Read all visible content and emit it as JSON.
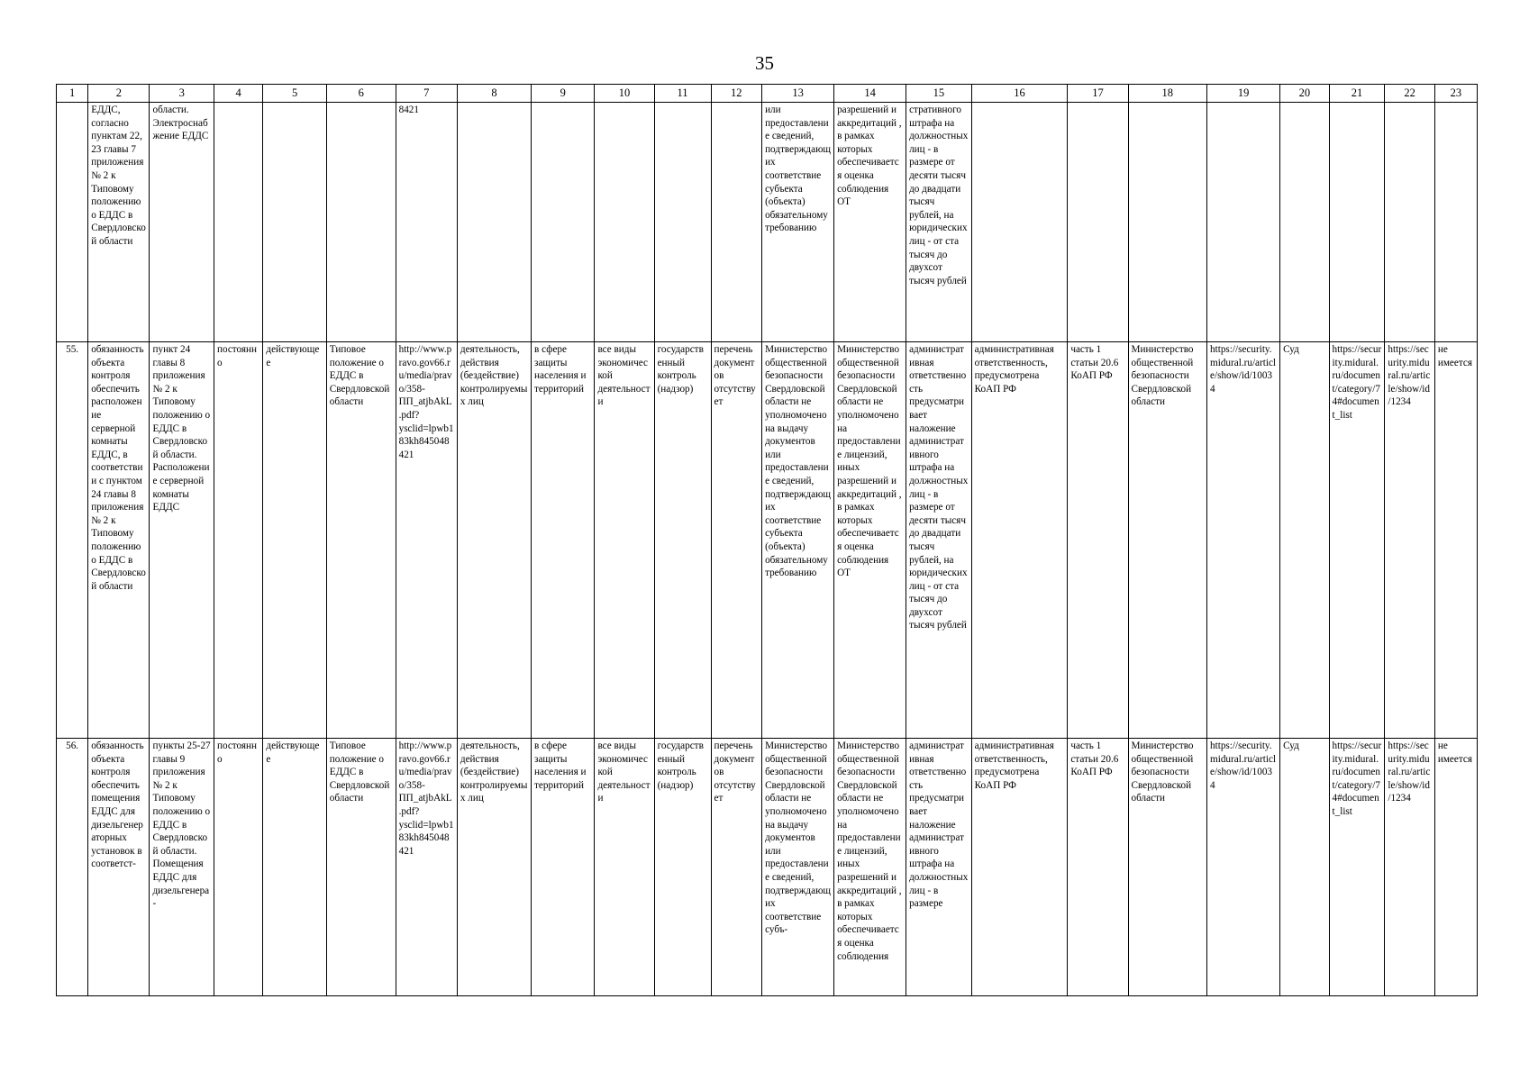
{
  "page": {
    "number": "35"
  },
  "table": {
    "column_headers": [
      "1",
      "2",
      "3",
      "4",
      "5",
      "6",
      "7",
      "8",
      "9",
      "10",
      "11",
      "12",
      "13",
      "14",
      "15",
      "16",
      "17",
      "18",
      "19",
      "20",
      "21",
      "22",
      "23"
    ],
    "rows": [
      {
        "name": "continuation-row",
        "cells": [
          "",
          "ЕДДС, согласно пунктам 22, 23 главы 7 приложения № 2 к Типовому положению о ЕДДС в Свердловской области",
          "области. Электроснабжение ЕДДС",
          "",
          "",
          "",
          "8421",
          "",
          "",
          "",
          "",
          "",
          "или предоставление сведений, подтверждающих соответствие субъекта (объекта) обязательному требованию",
          "разрешений и аккредитаций , в рамках которых обеспечивается оценка соблюдения ОТ",
          "стративного штрафа на должностных лиц - в размере от десяти тысяч до двадцати тысяч рублей, на юридических лиц - от ста тысяч до двухсот тысяч рублей",
          "",
          "",
          "",
          "",
          "",
          "",
          "",
          ""
        ]
      },
      {
        "name": "row-55",
        "cells": [
          "55.",
          "обязанность объекта контроля обеспечить расположение серверной комнаты ЕДДС, в соответствии с пунктом 24 главы 8 приложения № 2 к Типовому положению о ЕДДС в Свердловской области",
          "пункт 24 главы 8 приложения № 2 к Типовому положению о ЕДДС в Свердловской области. Расположение серверной комнаты ЕДДС",
          "постоянно",
          "действующее",
          "Типовое положение о ЕДДС в Свердловской области",
          "http://www.pravo.gov66.ru/media/pravo/358-ПП_atjbAkL.pdf?ysclid=lpwb183kh845048421",
          "деятельность, действия (бездействие) контролируемых лиц",
          "в сфере защиты населения и территорий",
          "все виды экономической деятельности",
          "государственный контроль (надзор)",
          "перечень документов отсутствует",
          "Министерство общественной безопасности Свердловской области не уполномочено на выдачу документов или предоставление сведений, подтверждающих соответствие субъекта (объекта) обязательному требованию",
          "Министерство общественной безопасности Свердловской области не уполномочено на предоставление лицензий, иных разрешений и аккредитаций , в рамках которых обеспечивается оценка соблюдения ОТ",
          "административная ответственность предусматривает наложение административного штрафа на должностных лиц - в размере от десяти тысяч до двадцати тысяч рублей, на юридических лиц - от ста тысяч до двухсот тысяч рублей",
          "административная ответственность, предусмотрена КоАП РФ",
          "часть 1 статьи 20.6 КоАП РФ",
          "Министерство общественной безопасности Свердловской области",
          "https://security.midural.ru/article/show/id/10034",
          "Суд",
          "https://security.midural.ru/document/category/74#document_list",
          "https://security.midural.ru/article/show/id/1234",
          "не имеется"
        ]
      },
      {
        "name": "row-56",
        "cells": [
          "56.",
          "обязанность объекта контроля обеспечить помещения ЕДДС для дизельгенераторных установок в соответст-",
          "пункты 25-27 главы 9 приложения № 2 к Типовому положению о ЕДДС в Свердловской области. Помещения ЕДДС для дизельгенера-",
          "постоянно",
          "действующее",
          "Типовое положение о ЕДДС в Свердловской области",
          "http://www.pravo.gov66.ru/media/pravo/358-ПП_atjbAkL.pdf?ysclid=lpwb183kh845048421",
          "деятельность, действия (бездействие) контролируемых лиц",
          "в сфере защиты населения и территорий",
          "все виды экономической деятельности",
          "государственный контроль (надзор)",
          "перечень документов отсутствует",
          "Министерство общественной безопасности Свердловской области не уполномочено на выдачу документов или предоставление сведений, подтверждающих соответствие субъ-",
          "Министерство общественной безопасности Свердловской области не уполномочено на предоставление лицензий, иных разрешений и аккредитаций , в рамках которых обеспечивается оценка соблюдения",
          "административная ответственность предусматривает наложение административного штрафа на должностных лиц - в размере",
          "административная ответственность, предусмотрена КоАП РФ",
          "часть 1 статьи 20.6 КоАП РФ",
          "Министерство общественной безопасности Свердловской области",
          "https://security.midural.ru/article/show/id/10034",
          "Суд",
          "https://security.midural.ru/document/category/74#document_list",
          "https://security.midural.ru/article/show/id/1234",
          "не имеется"
        ]
      }
    ]
  }
}
